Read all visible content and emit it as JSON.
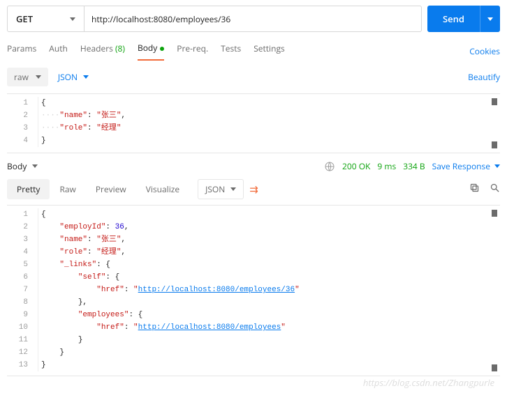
{
  "request": {
    "method": "GET",
    "url": "http://localhost:8080/employees/36",
    "send_label": "Send"
  },
  "req_tabs": {
    "params": "Params",
    "auth": "Auth",
    "headers": "Headers",
    "headers_count": "(8)",
    "body": "Body",
    "prereq": "Pre-req.",
    "tests": "Tests",
    "settings": "Settings",
    "cookies": "Cookies"
  },
  "body_bar": {
    "raw": "raw",
    "json": "JSON",
    "beautify": "Beautify"
  },
  "body_code": {
    "l1": "{",
    "l2_dots": "····",
    "l2_key": "\"name\"",
    "l2_sep": ": ",
    "l2_val": "\"张三\"",
    "l2_end": ",",
    "l3_dots": "····",
    "l3_key": "\"role\"",
    "l3_sep": ": ",
    "l3_val": "\"经理\"",
    "l4": "}"
  },
  "resp_bar": {
    "body": "Body",
    "status": "200 OK",
    "time": "9 ms",
    "size": "334 B",
    "save": "Save Response"
  },
  "resp_tabs": {
    "pretty": "Pretty",
    "raw": "Raw",
    "preview": "Preview",
    "visualize": "Visualize",
    "json": "JSON"
  },
  "resp_code": {
    "l1": "{",
    "l2_k": "\"employId\"",
    "l2_v": "36",
    "l3_k": "\"name\"",
    "l3_v": "\"张三\"",
    "l4_k": "\"role\"",
    "l4_v": "\"经理\"",
    "l5_k": "\"_links\"",
    "l6_k": "\"self\"",
    "l7_k": "\"href\"",
    "l7_v": "http://localhost:8080/employees/36",
    "l9_k": "\"employees\"",
    "l10_k": "\"href\"",
    "l10_v": "http://localhost:8080/employees",
    "brace_o": "{",
    "brace_c": "}",
    "end_c": "},"
  },
  "watermark": "https://blog.csdn.net/Zhangpurle"
}
